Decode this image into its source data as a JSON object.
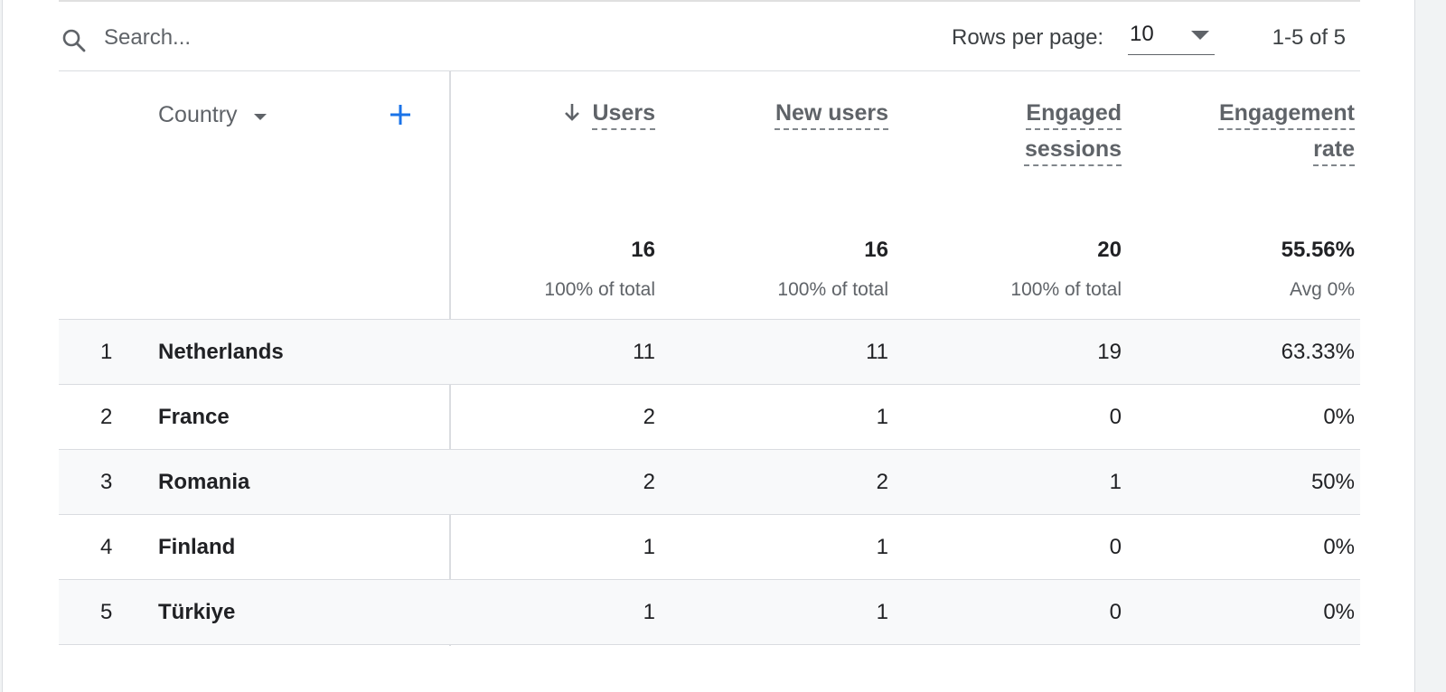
{
  "toolbar": {
    "search_placeholder": "Search...",
    "rows_per_page_label": "Rows per page:",
    "rows_per_page_value": "10",
    "page_range": "1-5 of 5"
  },
  "table": {
    "dimension_header": "Country",
    "columns": [
      {
        "label_lines": [
          "Users"
        ],
        "sorted": "descending",
        "total": "16",
        "total_note": "100% of total"
      },
      {
        "label_lines": [
          "New users"
        ],
        "total": "16",
        "total_note": "100% of total"
      },
      {
        "label_lines": [
          "Engaged",
          "sessions"
        ],
        "total": "20",
        "total_note": "100% of total"
      },
      {
        "label_lines": [
          "Engagement",
          "rate"
        ],
        "total": "55.56%",
        "total_note": "Avg 0%"
      }
    ],
    "rows": [
      {
        "index": "1",
        "country": "Netherlands",
        "values": [
          "11",
          "11",
          "19",
          "63.33%"
        ]
      },
      {
        "index": "2",
        "country": "France",
        "values": [
          "2",
          "1",
          "0",
          "0%"
        ]
      },
      {
        "index": "3",
        "country": "Romania",
        "values": [
          "2",
          "2",
          "1",
          "50%"
        ]
      },
      {
        "index": "4",
        "country": "Finland",
        "values": [
          "1",
          "1",
          "0",
          "0%"
        ]
      },
      {
        "index": "5",
        "country": "Türkiye",
        "values": [
          "1",
          "1",
          "0",
          "0%"
        ]
      }
    ]
  },
  "colors": {
    "accent": "#1a73e8",
    "row_alt": "#f8f9fa",
    "divider": "#dadce0"
  },
  "icons": {
    "search": "search-icon",
    "add_dimension": "plus-icon",
    "sort": "arrow-down-icon",
    "dropdown": "caret-down-icon"
  }
}
